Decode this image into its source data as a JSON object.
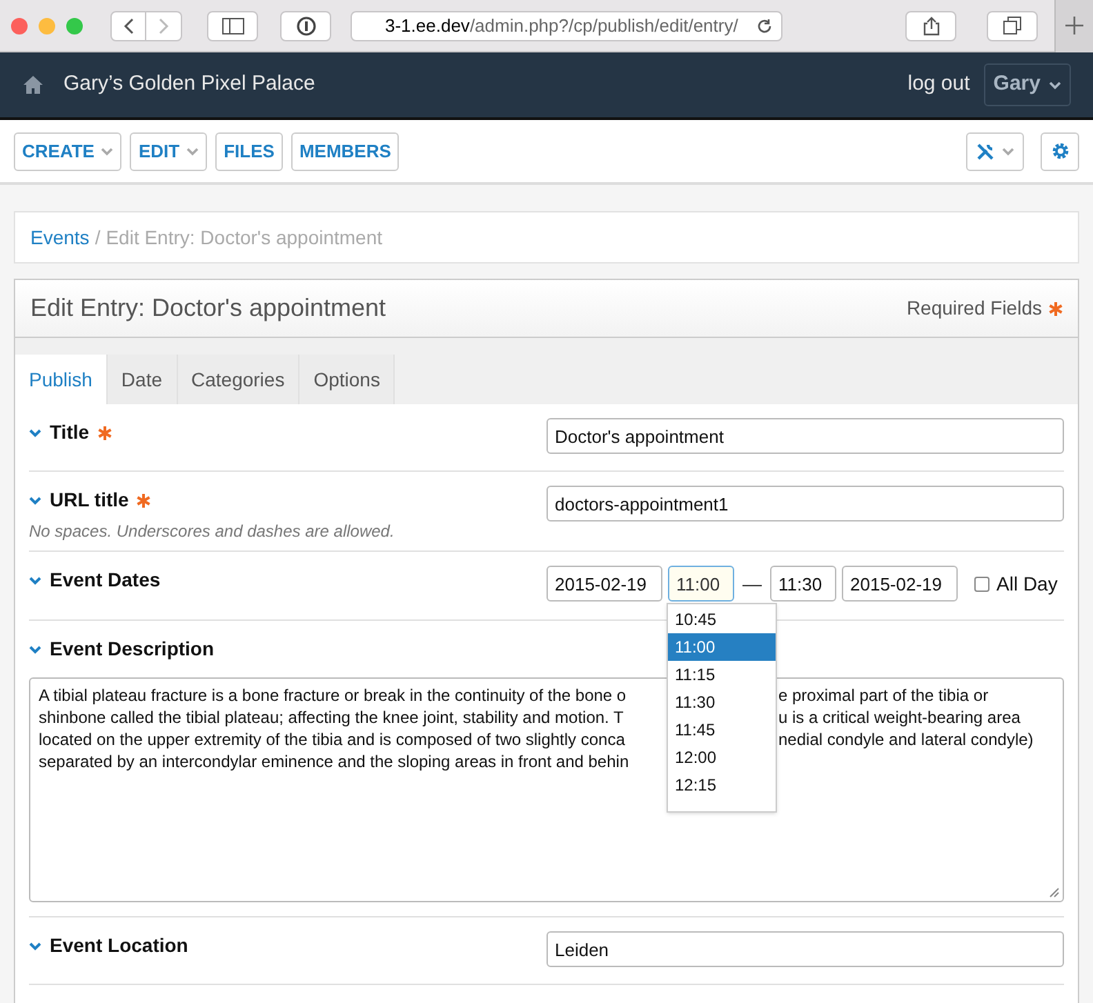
{
  "browser": {
    "url_host": "3-1.ee.dev",
    "url_path": "/admin.php?/cp/publish/edit/entry/"
  },
  "header": {
    "site_name": "Gary’s Golden Pixel Palace",
    "logout": "log out",
    "user": "Gary"
  },
  "nav": {
    "buttons": [
      {
        "label": "CREATE",
        "dropdown": true
      },
      {
        "label": "EDIT",
        "dropdown": true
      },
      {
        "label": "FILES",
        "dropdown": false
      },
      {
        "label": "MEMBERS",
        "dropdown": false
      }
    ]
  },
  "breadcrumb": {
    "link": "Events",
    "separator": "/",
    "current": "Edit Entry: Doctor's appointment"
  },
  "panel": {
    "title": "Edit Entry: Doctor's appointment",
    "required_note": "Required Fields"
  },
  "tabs": [
    {
      "label": "Publish",
      "selected": true
    },
    {
      "label": "Date",
      "selected": false
    },
    {
      "label": "Categories",
      "selected": false
    },
    {
      "label": "Options",
      "selected": false
    }
  ],
  "fields": [
    {
      "kind": "text",
      "label": "Title",
      "required": true,
      "value": "Doctor's appointment"
    },
    {
      "kind": "text",
      "label": "URL title",
      "required": true,
      "note": "No spaces. Underscores and dashes are allowed.",
      "value": "doctors-appointment1"
    },
    {
      "kind": "dates",
      "label": "Event Dates",
      "required": false,
      "start_date": "2015-02-19",
      "start_time": "11:00",
      "separator": "—",
      "end_time": "11:30",
      "end_date": "2015-02-19",
      "all_day": {
        "label": "All Day",
        "checked": false
      },
      "time_options": [
        {
          "label": "10:45",
          "selected": false
        },
        {
          "label": "11:00",
          "selected": true
        },
        {
          "label": "11:15",
          "selected": false
        },
        {
          "label": "11:30",
          "selected": false
        },
        {
          "label": "11:45",
          "selected": false
        },
        {
          "label": "12:00",
          "selected": false
        },
        {
          "label": "12:15",
          "selected": false
        }
      ]
    },
    {
      "kind": "textarea",
      "label": "Event Description",
      "required": false,
      "lines": [
        {
          "left": "A tibial plateau fracture is a bone fracture or break in the continuity of the bone o",
          "right": "e proximal part of the tibia or"
        },
        {
          "left": "shinbone called the tibial plateau; affecting the knee joint, stability and motion. T",
          "right": "u is a critical weight-bearing area"
        },
        {
          "left": "located on the upper extremity of the tibia and is composed of two slightly conca",
          "right": "nedial condyle and lateral condyle)"
        },
        {
          "left": "separated by an intercondylar eminence and the sloping areas in front and behin"
        }
      ]
    },
    {
      "kind": "text",
      "label": "Event Location",
      "required": false,
      "value": "Leiden"
    }
  ]
}
